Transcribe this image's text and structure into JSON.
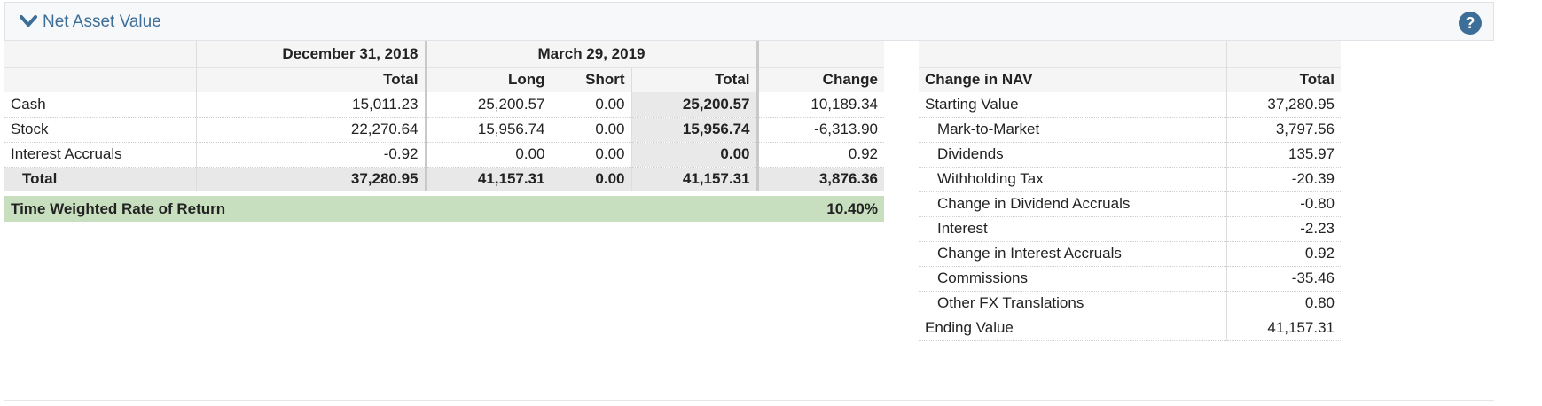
{
  "header": {
    "title": "Net Asset Value",
    "icons": {
      "toggle": "chevron-down-icon",
      "help": "help-icon"
    },
    "accent": "#3d6e98"
  },
  "nav": {
    "period1": "December 31, 2018",
    "period2": "March 29, 2019",
    "columns": {
      "total1": "Total",
      "long": "Long",
      "short": "Short",
      "total2": "Total",
      "change": "Change"
    },
    "rows": [
      {
        "label": "Cash",
        "total1": "15,011.23",
        "long": "25,200.57",
        "short": "0.00",
        "total2": "25,200.57",
        "change": "10,189.34"
      },
      {
        "label": "Stock",
        "total1": "22,270.64",
        "long": "15,956.74",
        "short": "0.00",
        "total2": "15,956.74",
        "change": "-6,313.90"
      },
      {
        "label": "Interest Accruals",
        "total1": "-0.92",
        "long": "0.00",
        "short": "0.00",
        "total2": "0.00",
        "change": "0.92"
      }
    ],
    "total_row": {
      "label": "Total",
      "total1": "37,280.95",
      "long": "41,157.31",
      "short": "0.00",
      "total2": "41,157.31",
      "change": "3,876.36"
    },
    "twr": {
      "label": "Time Weighted Rate of Return",
      "value": "10.40%",
      "color": "#c8dfbf"
    }
  },
  "change_in_nav": {
    "header_label": "Change in NAV",
    "header_total": "Total",
    "rows": [
      {
        "label": "Starting Value",
        "value": "37,280.95"
      },
      {
        "label": "Mark-to-Market",
        "value": "3,797.56"
      },
      {
        "label": "Dividends",
        "value": "135.97"
      },
      {
        "label": "Withholding Tax",
        "value": "-20.39"
      },
      {
        "label": "Change in Dividend Accruals",
        "value": "-0.80"
      },
      {
        "label": "Interest",
        "value": "-2.23"
      },
      {
        "label": "Change in Interest Accruals",
        "value": "0.92"
      },
      {
        "label": "Commissions",
        "value": "-35.46"
      },
      {
        "label": "Other FX Translations",
        "value": "0.80"
      },
      {
        "label": "Ending Value",
        "value": "41,157.31"
      }
    ]
  }
}
